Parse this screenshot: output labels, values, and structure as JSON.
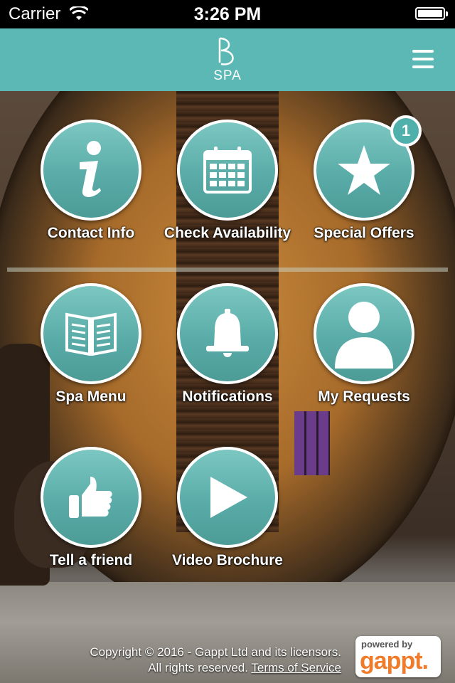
{
  "status_bar": {
    "carrier": "Carrier",
    "time": "3:26 PM"
  },
  "header": {
    "logo_text": "SPA"
  },
  "tiles": [
    {
      "label": "Contact Info",
      "icon": "info-icon"
    },
    {
      "label": "Check Availability",
      "icon": "calendar-icon"
    },
    {
      "label": "Special Offers",
      "icon": "star-icon",
      "badge": "1"
    },
    {
      "label": "Spa Menu",
      "icon": "book-icon"
    },
    {
      "label": "Notifications",
      "icon": "bell-icon"
    },
    {
      "label": "My Requests",
      "icon": "user-icon"
    },
    {
      "label": "Tell a friend",
      "icon": "thumbs-up-icon"
    },
    {
      "label": "Video Brochure",
      "icon": "play-icon"
    }
  ],
  "footer": {
    "copyright": "Copyright © 2016 - Gappt Ltd and its licensors.",
    "rights": "All rights reserved.",
    "terms_link": "Terms of Service",
    "powered_by": "powered by",
    "brand": "gappt."
  },
  "colors": {
    "accent": "#5bb8b4",
    "brand_orange": "#f07b2a"
  }
}
